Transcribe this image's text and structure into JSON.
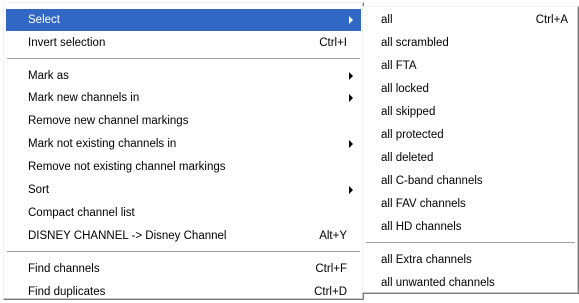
{
  "main_menu": {
    "items": [
      {
        "label": "Select",
        "shortcut": "",
        "submenu": true
      },
      {
        "label": "Invert selection",
        "shortcut": "Ctrl+I",
        "submenu": false
      },
      {
        "label": "Mark as",
        "shortcut": "",
        "submenu": true
      },
      {
        "label": "Mark new channels in",
        "shortcut": "",
        "submenu": true
      },
      {
        "label": "Remove new channel markings",
        "shortcut": "",
        "submenu": false
      },
      {
        "label": "Mark not existing channels in",
        "shortcut": "",
        "submenu": true
      },
      {
        "label": "Remove not existing channel markings",
        "shortcut": "",
        "submenu": false
      },
      {
        "label": "Sort",
        "shortcut": "",
        "submenu": true
      },
      {
        "label": "Compact channel list",
        "shortcut": "",
        "submenu": false
      },
      {
        "label": "DISNEY CHANNEL -> Disney Channel",
        "shortcut": "Alt+Y",
        "submenu": false
      },
      {
        "label": "Find channels",
        "shortcut": "Ctrl+F",
        "submenu": false
      },
      {
        "label": "Find duplicates",
        "shortcut": "Ctrl+D",
        "submenu": false
      }
    ]
  },
  "sub_menu": {
    "items": [
      {
        "label": "all",
        "shortcut": "Ctrl+A"
      },
      {
        "label": "all scrambled",
        "shortcut": ""
      },
      {
        "label": "all FTA",
        "shortcut": ""
      },
      {
        "label": "all locked",
        "shortcut": ""
      },
      {
        "label": "all skipped",
        "shortcut": ""
      },
      {
        "label": "all protected",
        "shortcut": ""
      },
      {
        "label": "all deleted",
        "shortcut": ""
      },
      {
        "label": "all C-band channels",
        "shortcut": ""
      },
      {
        "label": "all FAV channels",
        "shortcut": ""
      },
      {
        "label": "all HD channels",
        "shortcut": ""
      },
      {
        "label": "all Extra channels",
        "shortcut": ""
      },
      {
        "label": "all unwanted channels",
        "shortcut": ""
      }
    ]
  },
  "colors": {
    "highlight": "#3168c6",
    "highlight_text": "#ffffff",
    "menu_background": "#ffffff"
  },
  "icons": {
    "submenu_arrow": "chevron-right-icon"
  }
}
